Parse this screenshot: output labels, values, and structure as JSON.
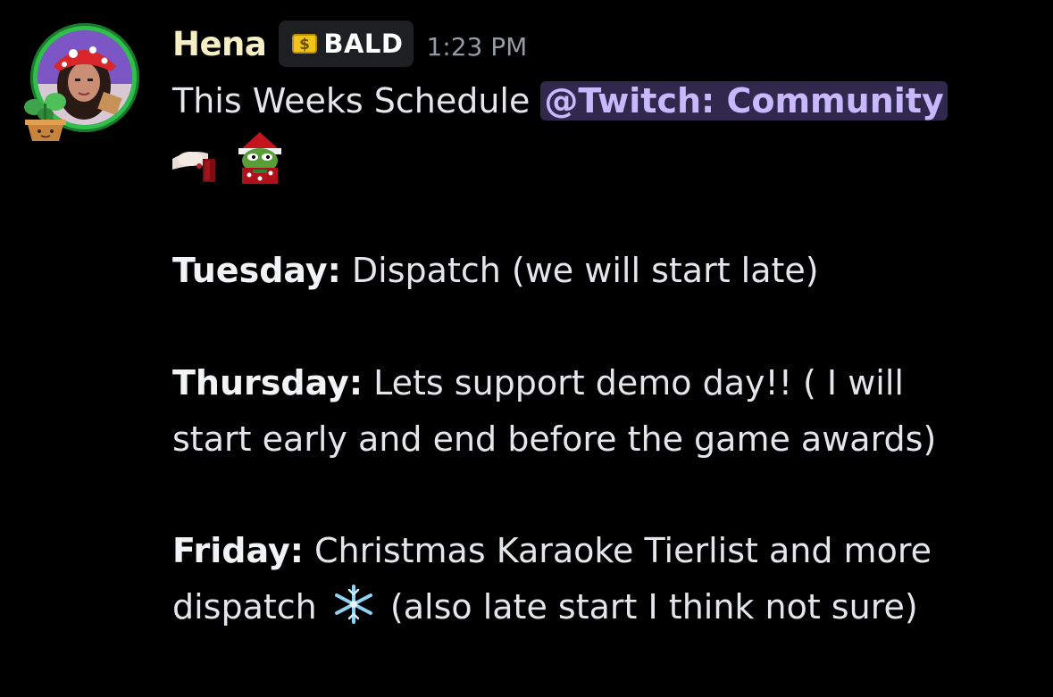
{
  "message": {
    "author": "Hena",
    "role_tag": "BALD",
    "timestamp": "1:23 PM",
    "intro": "This Weeks Schedule ",
    "mention": "@Twitch: Community",
    "tuesday_label": "Tuesday:",
    "tuesday_text": " Dispatch (we will start late)",
    "thursday_label": "Thursday:",
    "thursday_text_1": " Lets support demo day!! ( I will",
    "thursday_text_2": "start early and end before the game awards)",
    "friday_label": "Friday:",
    "friday_text_1": " Christmas Karaoke Tierlist and more",
    "friday_text_2a": "dispatch ",
    "friday_text_2b": " (also late start I think not sure)"
  },
  "icons": {
    "avatar": "user-avatar",
    "avatar_decoration": "potted-plant-icon",
    "tag_icon": "dollar-coin-icon",
    "emoji_1": "hand-holding-cup-emoji",
    "emoji_2": "christmas-pepe-emoji",
    "emoji_3": "snowflake-emoji"
  },
  "colors": {
    "background": "#000000",
    "username": "#f7efc4",
    "mention_bg": "#3b3260",
    "mention_text": "#c9b8ff",
    "timestamp": "#949ba4",
    "avatar_ring": "#2fbf4a"
  }
}
